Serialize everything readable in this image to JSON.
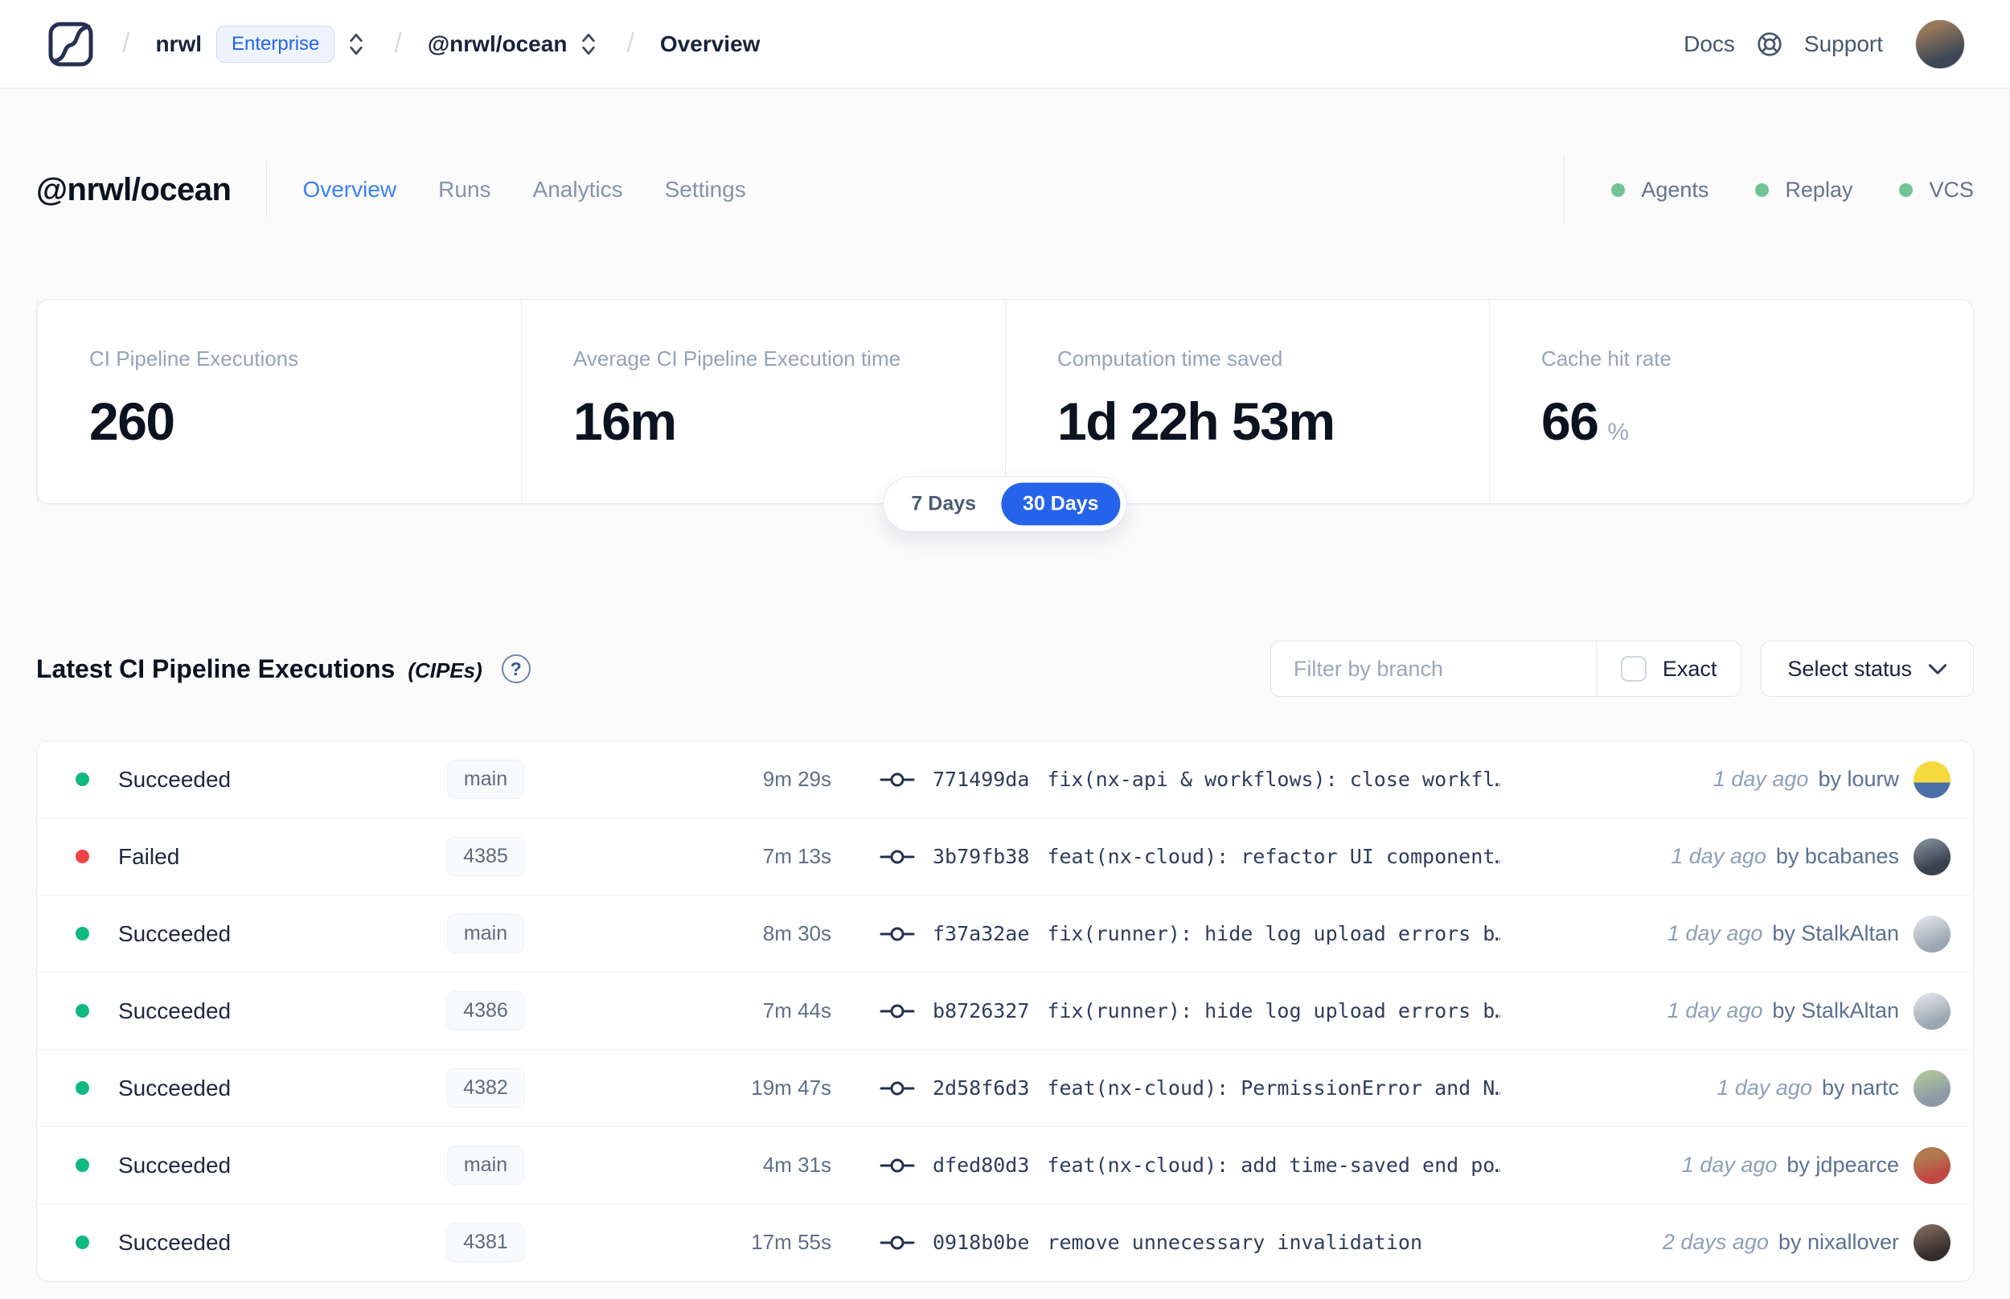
{
  "colors": {
    "accent_blue": "#2563eb",
    "tab_active_blue": "#3b82f6",
    "success_green": "#10b981",
    "failed_red": "#ef4444",
    "service_ok_green": "#6fc493"
  },
  "topnav": {
    "breadcrumb": {
      "separator": "/",
      "org": "nrwl",
      "org_badge": "Enterprise",
      "workspace": "@nrwl/ocean",
      "page": "Overview"
    },
    "links": {
      "docs": "Docs",
      "support": "Support"
    },
    "avatar_gradient": "linear-gradient(160deg,#96775b 20%,#3c4654 75%)"
  },
  "header": {
    "title": "@nrwl/ocean",
    "tabs": [
      {
        "label": "Overview",
        "active": true
      },
      {
        "label": "Runs",
        "active": false
      },
      {
        "label": "Analytics",
        "active": false
      },
      {
        "label": "Settings",
        "active": false
      }
    ],
    "services": [
      {
        "label": "Agents"
      },
      {
        "label": "Replay"
      },
      {
        "label": "VCS"
      }
    ]
  },
  "stats": {
    "cards": [
      {
        "label": "CI Pipeline Executions",
        "value": "260",
        "suffix": ""
      },
      {
        "label": "Average CI Pipeline Execution time",
        "value": "16m",
        "suffix": ""
      },
      {
        "label": "Computation time saved",
        "value": "1d 22h 53m",
        "suffix": ""
      },
      {
        "label": "Cache hit rate",
        "value": "66",
        "suffix": "%"
      }
    ],
    "range_toggle": {
      "options": [
        {
          "label": "7 Days",
          "selected": false
        },
        {
          "label": "30 Days",
          "selected": true
        }
      ]
    }
  },
  "cipe_section": {
    "title": "Latest CI Pipeline Executions",
    "title_suffix": "(CIPEs)",
    "help_glyph": "?",
    "filter_placeholder": "Filter by branch",
    "exact_label": "Exact",
    "exact_checked": false,
    "status_select_label": "Select status",
    "rows": [
      {
        "status": "Succeeded",
        "status_color": "#10b981",
        "branch": "main",
        "duration": "9m 29s",
        "commit_hash": "771499da",
        "commit_message": "fix(nx-api & workflows): close workfl…",
        "time": "1 day ago",
        "author": "by lourw",
        "avatar_gradient": "linear-gradient(180deg,#f6d93f 58%,#4b6fa8 58%)"
      },
      {
        "status": "Failed",
        "status_color": "#ef4444",
        "branch": "4385",
        "duration": "7m 13s",
        "commit_hash": "3b79fb38",
        "commit_message": "feat(nx-cloud): refactor UI component…",
        "time": "1 day ago",
        "author": "by bcabanes",
        "avatar_gradient": "linear-gradient(160deg,#8d99a6,#39414d 70%)"
      },
      {
        "status": "Succeeded",
        "status_color": "#10b981",
        "branch": "main",
        "duration": "8m 30s",
        "commit_hash": "f37a32ae",
        "commit_message": "fix(runner): hide log upload errors b…",
        "time": "1 day ago",
        "author": "by StalkAltan",
        "avatar_gradient": "linear-gradient(160deg,#e8ebee,#9aa6b1 75%)"
      },
      {
        "status": "Succeeded",
        "status_color": "#10b981",
        "branch": "4386",
        "duration": "7m 44s",
        "commit_hash": "b8726327",
        "commit_message": "fix(runner): hide log upload errors b…",
        "time": "1 day ago",
        "author": "by StalkAltan",
        "avatar_gradient": "linear-gradient(160deg,#e8ebee,#9aa6b1 75%)"
      },
      {
        "status": "Succeeded",
        "status_color": "#10b981",
        "branch": "4382",
        "duration": "19m 47s",
        "commit_hash": "2d58f6d3",
        "commit_message": "feat(nx-cloud): PermissionError and N…",
        "time": "1 day ago",
        "author": "by nartc",
        "avatar_gradient": "linear-gradient(160deg,#b9cf9a,#8d9aa6 70%)"
      },
      {
        "status": "Succeeded",
        "status_color": "#10b981",
        "branch": "main",
        "duration": "4m 31s",
        "commit_hash": "dfed80d3",
        "commit_message": "feat(nx-cloud): add time-saved end po…",
        "time": "1 day ago",
        "author": "by jdpearce",
        "avatar_gradient": "linear-gradient(160deg,#b07a4e 30%,#c04a43 70%)"
      },
      {
        "status": "Succeeded",
        "status_color": "#10b981",
        "branch": "4381",
        "duration": "17m 55s",
        "commit_hash": "0918b0be",
        "commit_message": "remove unnecessary invalidation",
        "time": "2 days ago",
        "author": "by nixallover",
        "avatar_gradient": "linear-gradient(160deg,#8a7365,#332c29 75%)"
      }
    ]
  }
}
